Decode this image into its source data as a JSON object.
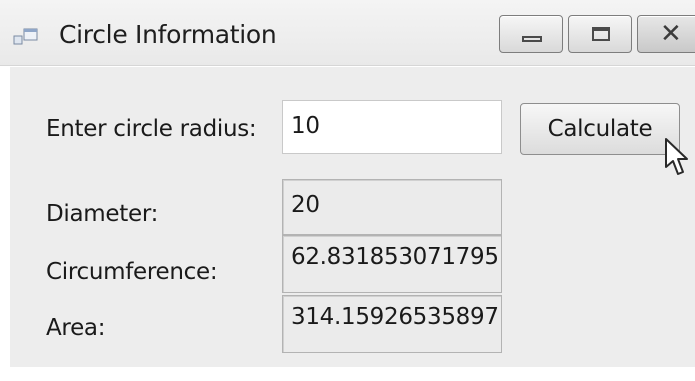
{
  "window": {
    "title": "Circle Information"
  },
  "icons": {
    "app": "window-app-icon",
    "minimize": "minimize-icon",
    "maximize": "maximize-icon",
    "close": "close-icon",
    "cursor": "mouse-pointer-icon"
  },
  "form": {
    "radius_label": "Enter circle radius:",
    "radius_value": "10",
    "calculate_label": "Calculate",
    "diameter_label": "Diameter:",
    "diameter_value": "20",
    "circumference_label": "Circumference:",
    "circumference_value": "62.831853071795",
    "area_label": "Area:",
    "area_value": "314.15926535897"
  }
}
